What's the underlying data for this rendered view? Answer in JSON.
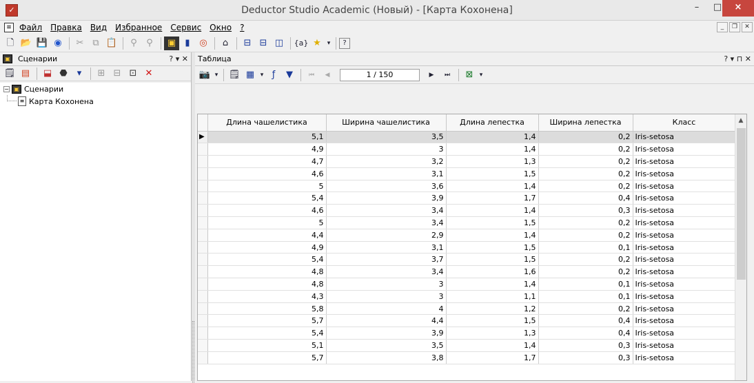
{
  "window": {
    "title": "Deductor Studio Academic (Новый) - [Карта Кохонена]",
    "min_glyph": "–",
    "max_glyph": "□",
    "close_glyph": "×"
  },
  "menu": {
    "items": [
      "Файл",
      "Правка",
      "Вид",
      "Избранное",
      "Сервис",
      "Окно",
      "?"
    ]
  },
  "left_pane": {
    "title": "Сценарии",
    "header_buttons": "? ▾ ✕",
    "tree": {
      "root_label": "Сценарии",
      "child_label": "Карта Кохонена"
    }
  },
  "right_pane": {
    "title": "Таблица",
    "header_buttons": "? ▾ ⊓ ✕",
    "nav": {
      "position": "1 / 150"
    }
  },
  "table": {
    "columns": [
      "Длина чашелистика",
      "Ширина чашелистика",
      "Длина лепестка",
      "Ширина лепестка",
      "Класс"
    ],
    "rows": [
      [
        "5,1",
        "3,5",
        "1,4",
        "0,2",
        "Iris-setosa"
      ],
      [
        "4,9",
        "3",
        "1,4",
        "0,2",
        "Iris-setosa"
      ],
      [
        "4,7",
        "3,2",
        "1,3",
        "0,2",
        "Iris-setosa"
      ],
      [
        "4,6",
        "3,1",
        "1,5",
        "0,2",
        "Iris-setosa"
      ],
      [
        "5",
        "3,6",
        "1,4",
        "0,2",
        "Iris-setosa"
      ],
      [
        "5,4",
        "3,9",
        "1,7",
        "0,4",
        "Iris-setosa"
      ],
      [
        "4,6",
        "3,4",
        "1,4",
        "0,3",
        "Iris-setosa"
      ],
      [
        "5",
        "3,4",
        "1,5",
        "0,2",
        "Iris-setosa"
      ],
      [
        "4,4",
        "2,9",
        "1,4",
        "0,2",
        "Iris-setosa"
      ],
      [
        "4,9",
        "3,1",
        "1,5",
        "0,1",
        "Iris-setosa"
      ],
      [
        "5,4",
        "3,7",
        "1,5",
        "0,2",
        "Iris-setosa"
      ],
      [
        "4,8",
        "3,4",
        "1,6",
        "0,2",
        "Iris-setosa"
      ],
      [
        "4,8",
        "3",
        "1,4",
        "0,1",
        "Iris-setosa"
      ],
      [
        "4,3",
        "3",
        "1,1",
        "0,1",
        "Iris-setosa"
      ],
      [
        "5,8",
        "4",
        "1,2",
        "0,2",
        "Iris-setosa"
      ],
      [
        "5,7",
        "4,4",
        "1,5",
        "0,4",
        "Iris-setosa"
      ],
      [
        "5,4",
        "3,9",
        "1,3",
        "0,4",
        "Iris-setosa"
      ],
      [
        "5,1",
        "3,5",
        "1,4",
        "0,3",
        "Iris-setosa"
      ],
      [
        "5,7",
        "3,8",
        "1,7",
        "0,3",
        "Iris-setosa"
      ]
    ],
    "selected_row_index": 0,
    "row_indicator": "▶"
  },
  "icons": {
    "toolbar": [
      "new-icon",
      "open-icon",
      "save-icon",
      "globe-icon",
      "cut-icon",
      "copy-icon",
      "paste-icon",
      "find-icon",
      "find-next-icon",
      "scenario-icon",
      "book-icon",
      "wizard-icon",
      "home-icon",
      "split-icon",
      "layout-icon",
      "columns-icon",
      "variables-icon",
      "star-icon",
      "help-icon"
    ]
  },
  "colors": {
    "close_button": "#c7463e",
    "selected_row": "#dcdcdc"
  }
}
